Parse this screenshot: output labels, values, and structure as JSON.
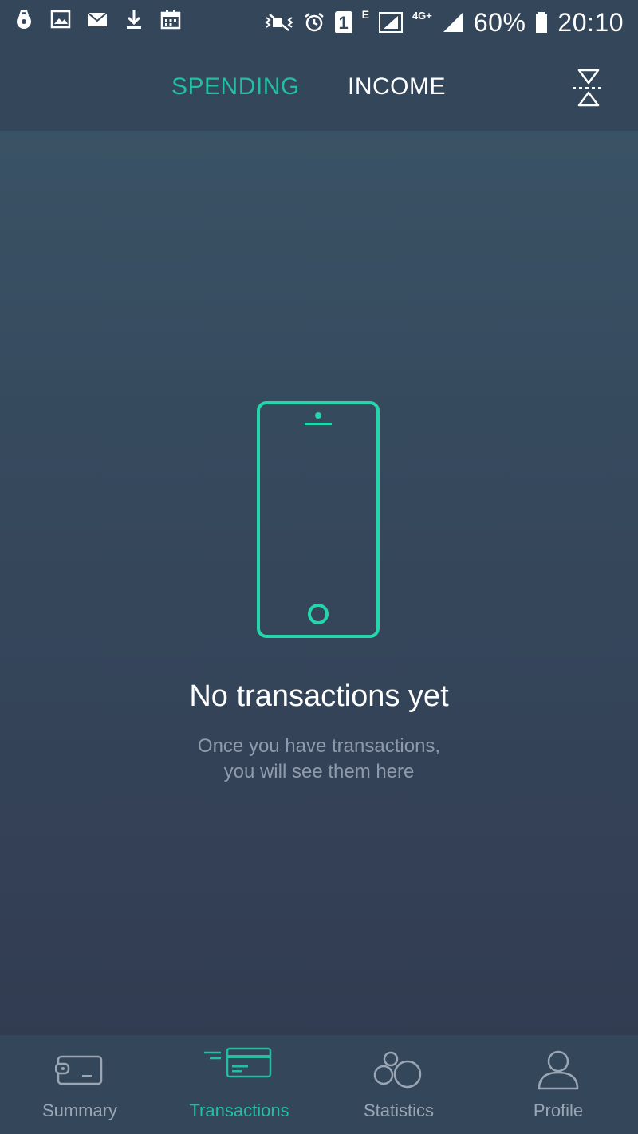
{
  "status_bar": {
    "battery": "60%",
    "time": "20:10",
    "network": "4G+",
    "sim": "1",
    "data_indicator": "E",
    "icons_left": [
      "lock-notification-icon",
      "image-icon",
      "mail-icon",
      "download-icon",
      "calendar-icon"
    ],
    "icons_right": [
      "vibrate-icon",
      "alarm-icon",
      "sim-icon",
      "signal-icon",
      "battery-icon"
    ]
  },
  "header": {
    "tabs": [
      {
        "label": "SPENDING",
        "active": true
      },
      {
        "label": "INCOME",
        "active": false
      }
    ],
    "filter_icon": "hourglass-filter-icon"
  },
  "empty_state": {
    "icon": "smartphone-icon",
    "title": "No transactions yet",
    "subtitle_line1": "Once you have transactions,",
    "subtitle_line2": "you will see them here"
  },
  "bottom_nav": {
    "items": [
      {
        "label": "Summary",
        "icon": "wallet-icon",
        "active": false
      },
      {
        "label": "Transactions",
        "icon": "card-icon",
        "active": true
      },
      {
        "label": "Statistics",
        "icon": "bubbles-icon",
        "active": false
      },
      {
        "label": "Profile",
        "icon": "person-icon",
        "active": false
      }
    ]
  },
  "colors": {
    "accent": "#24bfa0",
    "bar_background": "#34465a",
    "inactive_text": "#9aa6b4"
  }
}
